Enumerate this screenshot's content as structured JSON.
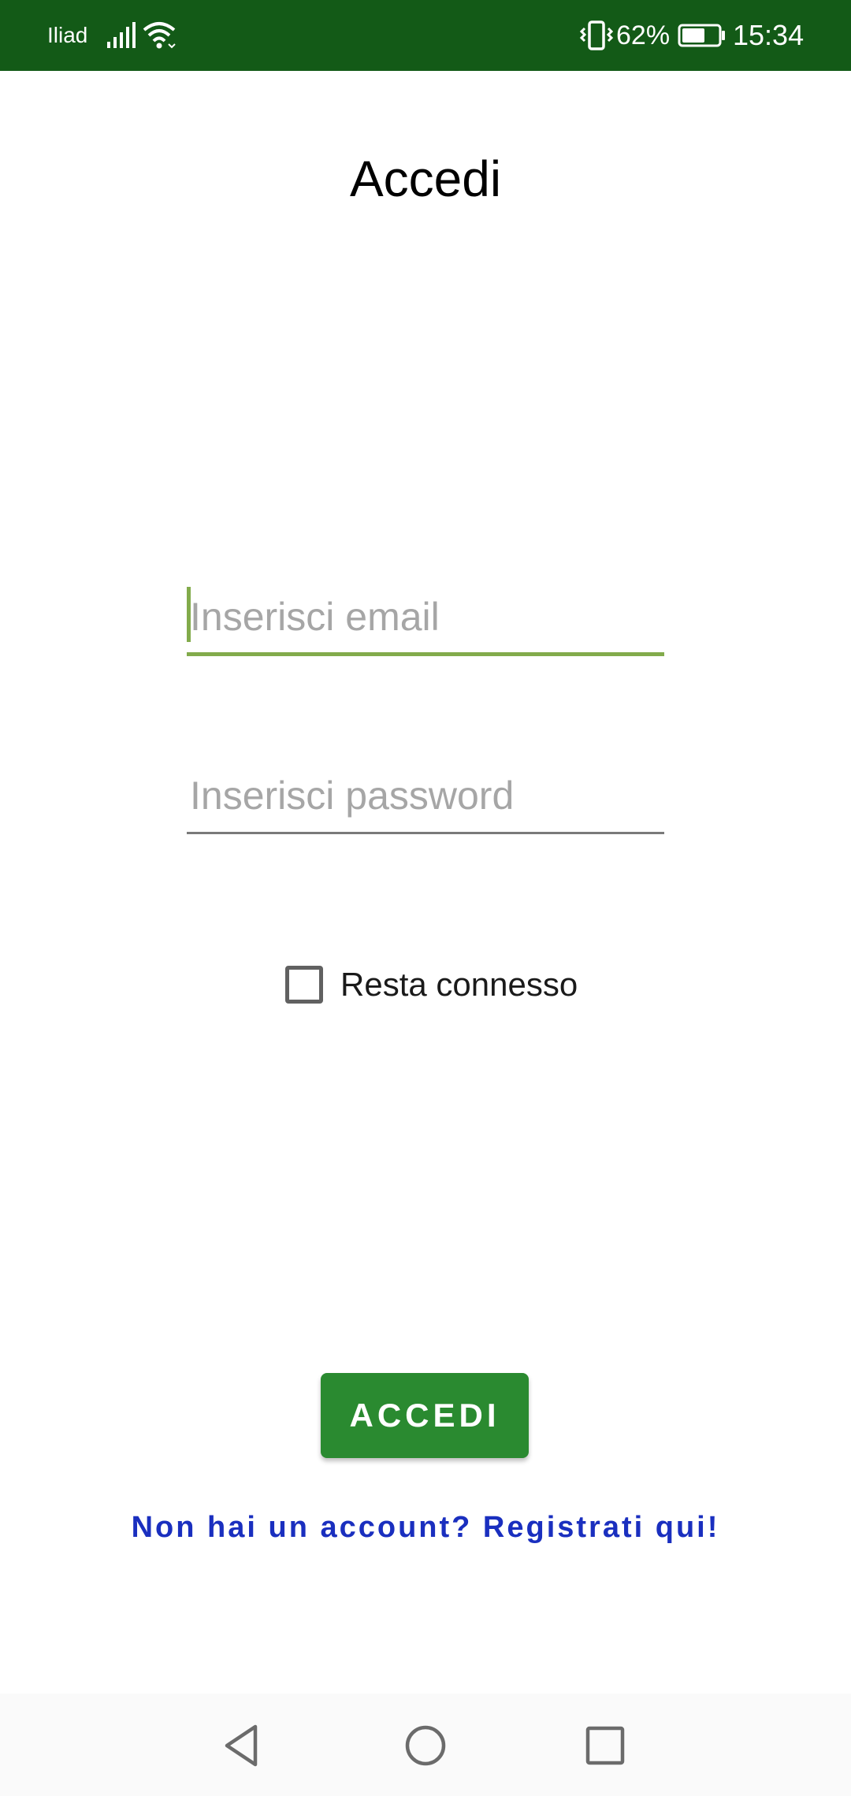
{
  "status_bar": {
    "carrier": "Iliad",
    "battery_percent": "62%",
    "time": "15:34",
    "icons": [
      "signal-icon",
      "wifi-icon",
      "vibrate-icon",
      "battery-icon"
    ],
    "background_color": "#135a17"
  },
  "title": "Accedi",
  "email_field": {
    "placeholder": "Inserisci email",
    "value": "",
    "focused": true,
    "accent_color": "#82ab4b"
  },
  "password_field": {
    "placeholder": "Inserisci password",
    "value": ""
  },
  "remember_me": {
    "label": "Resta connesso",
    "checked": false
  },
  "login_button": {
    "label": "ACCEDI",
    "color": "#2a8a30"
  },
  "register_link": {
    "text": "Non hai un account? Registrati qui!",
    "color": "#1a2fbf"
  },
  "nav_bar": {
    "icons": [
      "back-icon",
      "home-icon",
      "recents-icon"
    ]
  }
}
